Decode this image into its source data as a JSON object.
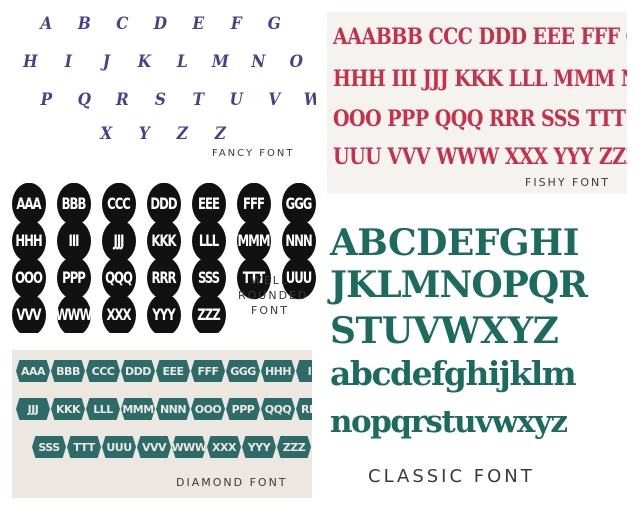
{
  "colors": {
    "fancy": "#4a3f8e",
    "fishy": "#c6304a",
    "well_rounded": "#111111",
    "diamond": "#2d6b69",
    "classic": "#1d6b5e"
  },
  "fancy": {
    "caption": "FANCY FONT",
    "rows": [
      [
        "A",
        "B",
        "C",
        "D",
        "E",
        "F",
        "G"
      ],
      [
        "H",
        "I",
        "J",
        "K",
        "L",
        "M",
        "N",
        "O"
      ],
      [
        "P",
        "Q",
        "R",
        "S",
        "T",
        "U",
        "V",
        "W"
      ],
      [
        "X",
        "Y",
        "Z",
        "Z"
      ]
    ]
  },
  "fishy": {
    "caption": "FISHY FONT",
    "rows": [
      "AAABBB CCC DDD EEE FFF GGG",
      "HHH III JJJ KKK LLL MMM NNN",
      "OOO PPP QQQ RRR SSS TTT",
      "UUU VVV WWW XXX YYY ZZZ"
    ]
  },
  "well_rounded": {
    "caption_lines": [
      "WELL",
      "ROUNDED",
      "FONT"
    ],
    "rows": [
      [
        "AAA",
        "BBB",
        "CCC",
        "DDD",
        "EEE",
        "FFF",
        "GGG"
      ],
      [
        "HHH",
        "III",
        "JJJ",
        "KKK",
        "LLL",
        "MMM",
        "NNN"
      ],
      [
        "OOO",
        "PPP",
        "QQQ",
        "RRR",
        "SSS",
        "TTT",
        "UUU"
      ],
      [
        "VVV",
        "WWW",
        "XXX",
        "YYY",
        "ZZZ"
      ]
    ]
  },
  "diamond": {
    "caption": "DIAMOND FONT",
    "rows": [
      [
        "AAA",
        "BBB",
        "CCC",
        "DDD",
        "EEE",
        "FFF",
        "GGG",
        "HHH",
        "III"
      ],
      [
        "JJJ",
        "KKK",
        "LLL",
        "MMM",
        "NNN",
        "OOO",
        "PPP",
        "QQQ",
        "RRR"
      ],
      [
        "SSS",
        "TTT",
        "UUU",
        "VVV",
        "WWW",
        "XXX",
        "YYY",
        "ZZZ"
      ]
    ]
  },
  "classic": {
    "caption": "CLASSIC FONT",
    "lines": [
      "ABCDEFGHI",
      "JKLMNOPQR",
      "STUVWXYZ",
      "abcdefghijklm",
      "nopqrstuvwxyz"
    ]
  }
}
